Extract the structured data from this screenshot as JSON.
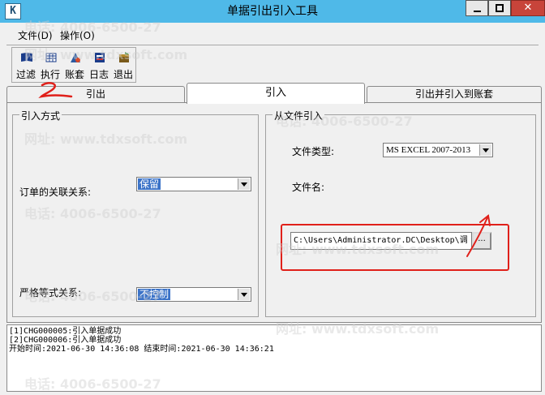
{
  "window": {
    "title": "单据引出引入工具",
    "close_glyph": "✕"
  },
  "menu": {
    "file": "文件(D)",
    "operate": "操作(O)"
  },
  "toolbar": [
    {
      "label": "过滤",
      "icon": "filter-book-icon"
    },
    {
      "label": "执行",
      "icon": "execute-grid-icon"
    },
    {
      "label": "账套",
      "icon": "account-set-icon"
    },
    {
      "label": "日志",
      "icon": "log-icon"
    },
    {
      "label": "退出",
      "icon": "exit-icon"
    }
  ],
  "tabs": [
    "引出",
    "引入",
    "引出并引入到账套"
  ],
  "import_method": {
    "group_title": "引入方式",
    "order_relation_label": "订单的关联关系:",
    "order_relation_value": "保留",
    "strict_label": "严格等式关系:",
    "strict_value": "不控制"
  },
  "from_file": {
    "group_title": "从文件引入",
    "file_type_label": "文件类型:",
    "file_type_value": "MS EXCEL 2007-2013",
    "file_name_label": "文件名:",
    "file_path": "C:\\Users\\Administrator.DC\\Desktop\\调",
    "browse_label": "..."
  },
  "log": [
    "[1]CHG000005:引入单据成功",
    "[2]CHG000006:引入单据成功",
    "开始时间:2021-06-30 14:36:08 结束时间:2021-06-30 14:36:21"
  ],
  "watermark": {
    "phone": "电话: 4006-6500-27",
    "site": "网址: www.tdxsoft.com"
  },
  "colors": {
    "titlebar": "#4fb9e8",
    "selection": "#3b73c8",
    "annotation": "#e0201a"
  }
}
